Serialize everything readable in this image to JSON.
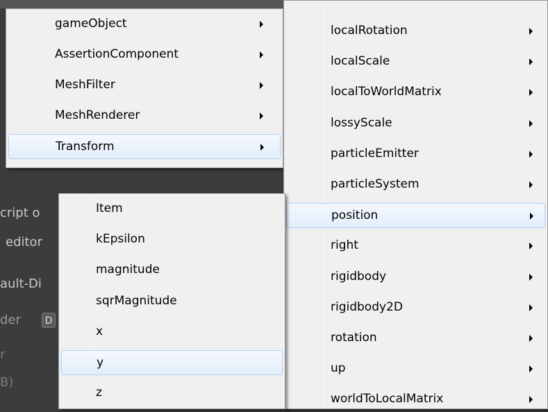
{
  "background": {
    "fragments": [
      "cript o",
      "editor",
      "ault-Di",
      "der",
      "D",
      "r",
      "B)"
    ]
  },
  "menu_components": {
    "items": [
      {
        "label": "gameObject",
        "has_submenu": true
      },
      {
        "label": "AssertionComponent",
        "has_submenu": true
      },
      {
        "label": "MeshFilter",
        "has_submenu": true
      },
      {
        "label": "MeshRenderer",
        "has_submenu": true
      },
      {
        "label": "Transform",
        "has_submenu": true,
        "highlighted": true
      }
    ]
  },
  "menu_transform": {
    "items": [
      {
        "label": "localRotation"
      },
      {
        "label": "localScale"
      },
      {
        "label": "localToWorldMatrix"
      },
      {
        "label": "lossyScale"
      },
      {
        "label": "particleEmitter"
      },
      {
        "label": "particleSystem"
      },
      {
        "label": "position",
        "highlighted": true
      },
      {
        "label": "right"
      },
      {
        "label": "rigidbody"
      },
      {
        "label": "rigidbody2D"
      },
      {
        "label": "rotation"
      },
      {
        "label": "up"
      },
      {
        "label": "worldToLocalMatrix"
      }
    ]
  },
  "menu_position": {
    "items": [
      {
        "label": "Item"
      },
      {
        "label": "kEpsilon"
      },
      {
        "label": "magnitude"
      },
      {
        "label": "sqrMagnitude"
      },
      {
        "label": "x"
      },
      {
        "label": "y",
        "highlighted": true
      },
      {
        "label": "z"
      }
    ]
  },
  "colors": {
    "menu_bg": "#f0f0f0",
    "highlight_border": "#aecff7",
    "editor_bg": "#3c3c3c"
  }
}
